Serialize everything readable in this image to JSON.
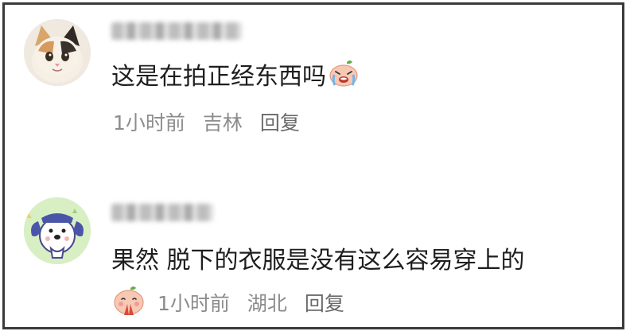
{
  "comments": [
    {
      "username": "",
      "text": "这是在拍正经东西吗",
      "inline_emoji": "crying-face-emoji",
      "time": "1小时前",
      "location": "吉林",
      "reply_label": "回复",
      "avatar_icon": "kitten-avatar"
    },
    {
      "username": "",
      "text": "果然 脱下的衣服是没有这么容易穿上的",
      "meta_emoji": "praying-face-emoji",
      "time": "1小时前",
      "location": "湖北",
      "reply_label": "回复",
      "avatar_icon": "cartoon-dog-avatar"
    }
  ],
  "colors": {
    "text": "#1e1e1e",
    "meta": "#8c8c8c",
    "frame_border": "#3a3a3a"
  }
}
